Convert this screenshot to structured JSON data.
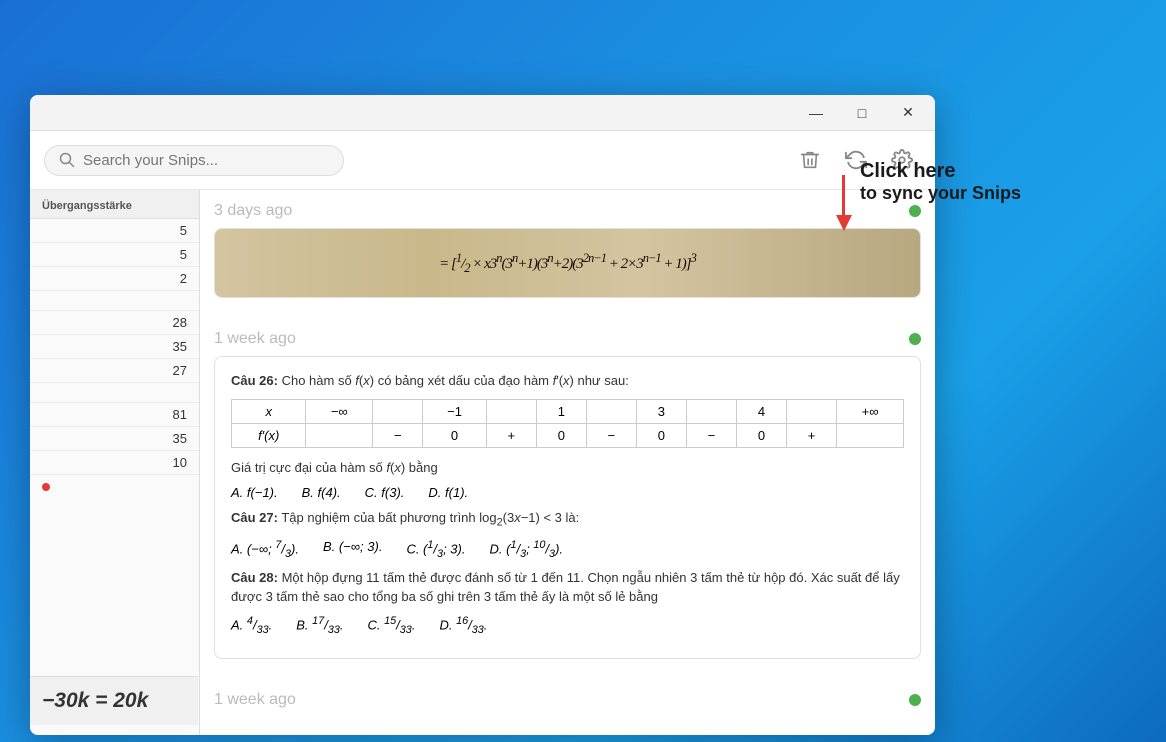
{
  "window": {
    "title_bar": {
      "minimize_label": "—",
      "maximize_label": "□",
      "close_label": "✕"
    }
  },
  "toolbar": {
    "search_placeholder": "Search your Snips...",
    "delete_label": "🗑",
    "sync_label": "↻",
    "settings_label": "⚙"
  },
  "sidebar": {
    "header": "Übergangsstärke",
    "rows": [
      {
        "value": "5"
      },
      {
        "value": "5"
      },
      {
        "value": "2"
      },
      {
        "value": ""
      },
      {
        "value": "28"
      },
      {
        "value": "35"
      },
      {
        "value": "27"
      },
      {
        "value": ""
      },
      {
        "value": "81"
      },
      {
        "value": "35"
      },
      {
        "value": "10"
      }
    ],
    "bottom_text": "−30k = 20k"
  },
  "snips": [
    {
      "timestamp": "3 days ago",
      "has_dot": true,
      "dot_color": "#4caf50",
      "type": "handwritten",
      "content": "= [1/2 × x3ⁿ(3ⁿ+1)(3ⁿ+2)(3^(2n-1) + 2×3^(n-1) + 1)]³"
    },
    {
      "timestamp": "1 week ago",
      "has_dot": true,
      "dot_color": "#4caf50",
      "type": "math",
      "q26": {
        "label": "Câu 26:",
        "text": "Cho hàm số f(x) có bảng xét dấu của đạo hàm f′(x) như sau:",
        "table_headers": [
          "x",
          "−∞",
          "",
          "−1",
          "",
          "1",
          "",
          "3",
          "",
          "4",
          "",
          "+∞"
        ],
        "table_row": [
          "f′(x)",
          "",
          "−",
          "",
          "0",
          "",
          "+",
          "",
          "0",
          "",
          "−",
          "",
          "0",
          "",
          "−",
          "",
          "0",
          "",
          "+"
        ],
        "question": "Giá trị cực đại của hàm số f(x) bằng",
        "answers": [
          "A. f(−1).",
          "B. f(4).",
          "C. f(3).",
          "D. f(1)."
        ]
      },
      "q27": {
        "label": "Câu 27:",
        "text": "Tập nghiệm của bất phương trình log₂(3x−1) < 3 là:",
        "answers": [
          "A. (−∞; 7/3).",
          "B. (−∞; 3).",
          "C. (1/3; 3).",
          "D. (1/3; 10/3)."
        ]
      },
      "q28": {
        "label": "Câu 28:",
        "text": "Một hộp đựng 11 tấm thẻ được đánh số từ 1 đến 11. Chọn ngẫu nhiên 3 tấm thẻ từ hộp đó. Xác suất để lấy được 3 tấm thẻ sao cho tổng ba số ghi trên 3 tấm thẻ ấy là một số lẻ bằng",
        "answers": [
          "A. 4/33.",
          "B. 17/33.",
          "C. 15/33.",
          "D. 16/33."
        ]
      }
    }
  ],
  "tooltip": {
    "line1": "Click here",
    "line2": "to sync your Snips"
  }
}
